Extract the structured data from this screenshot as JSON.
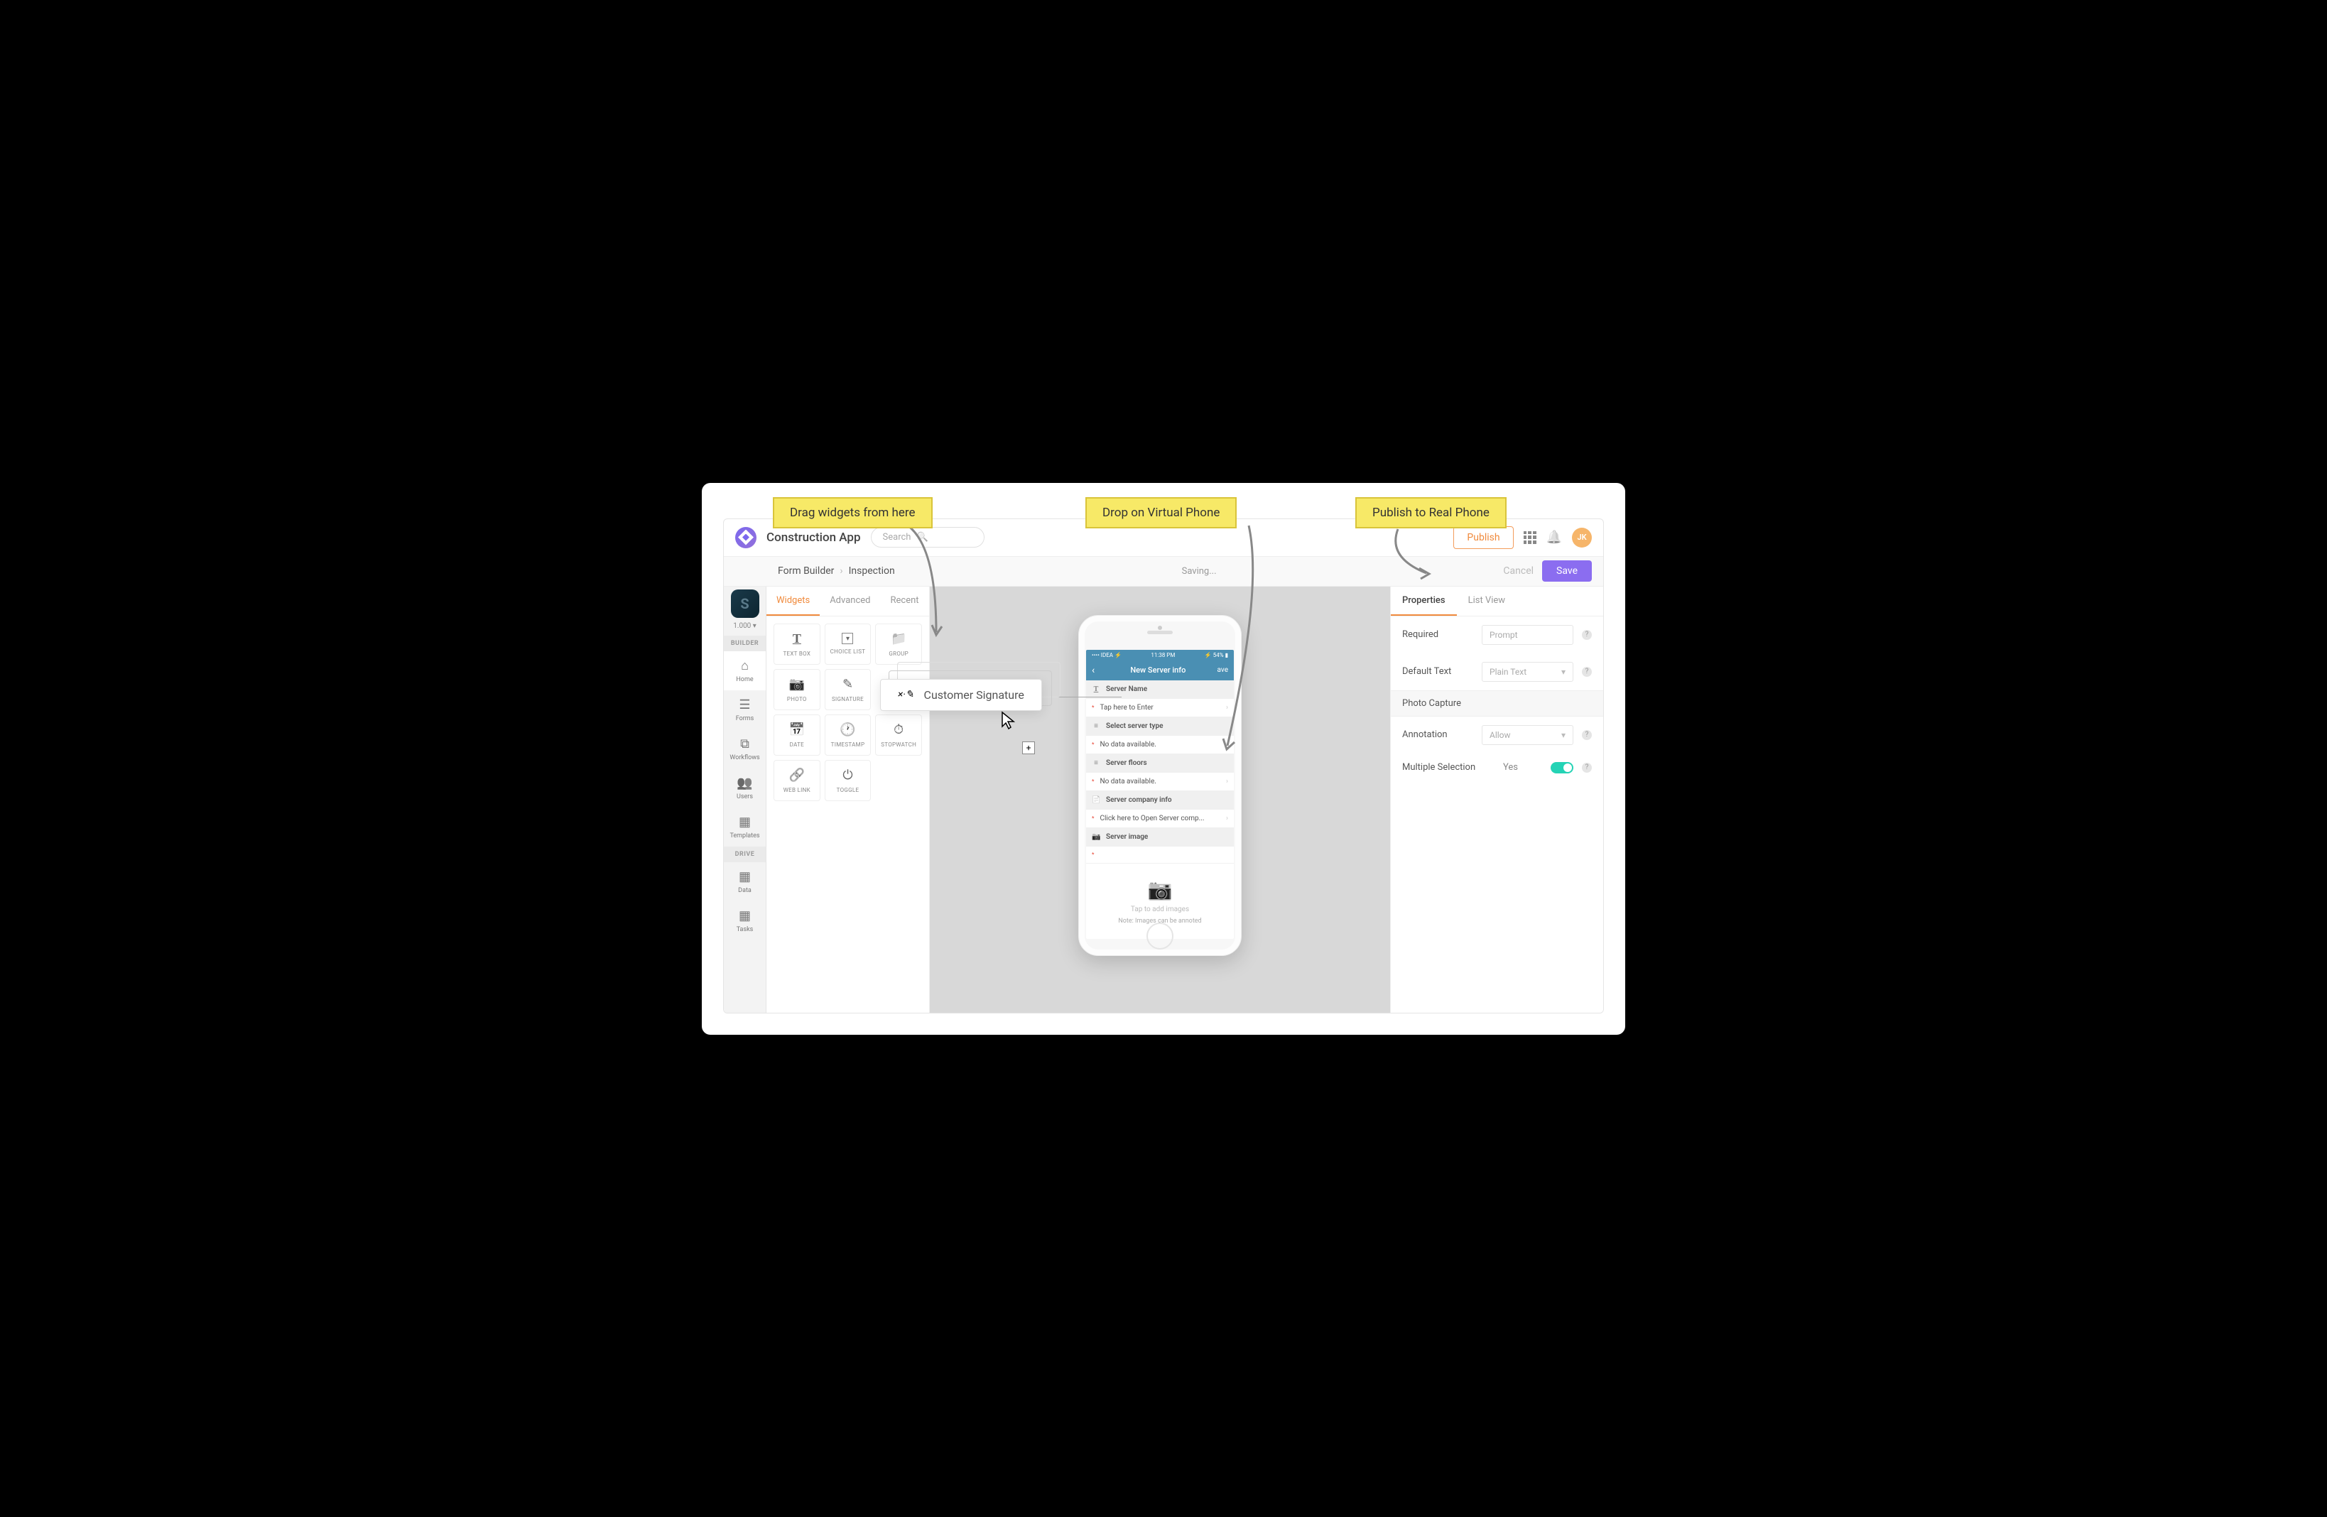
{
  "callouts": {
    "drag": "Drag widgets from here",
    "drop": "Drop on Virtual Phone",
    "publish": "Publish to Real Phone"
  },
  "header": {
    "app_title": "Construction App",
    "search_placeholder": "Search",
    "publish": "Publish",
    "avatar_initials": "JK"
  },
  "subheader": {
    "form_builder": "Form Builder",
    "crumb": "Inspection",
    "status": "Saving...",
    "cancel": "Cancel",
    "save": "Save"
  },
  "sidebar": {
    "version": "1.000",
    "builder_label": "BUILDER",
    "drive_label": "DRIVE",
    "items": {
      "home": "Home",
      "forms": "Forms",
      "workflows": "Workflows",
      "users": "Users",
      "templates": "Templates",
      "data": "Data",
      "tasks": "Tasks"
    }
  },
  "wtabs": {
    "widgets": "Widgets",
    "advanced": "Advanced",
    "recent": "Recent"
  },
  "widgets": {
    "text": "TEXT BOX",
    "choice": "CHOICE LIST",
    "group": "GROUP",
    "photo": "PHOTO",
    "sig": "SIGNATURE",
    "date": "DATE",
    "time": "TIMESTAMP",
    "stop": "STOPWATCH",
    "link": "WEB LINK",
    "toggle": "TOGGLE"
  },
  "drag_ghost": {
    "label": "Customer Signature",
    "sig_mark": "×·✎"
  },
  "phone": {
    "carrier": "IDEA",
    "time": "11:38 PM",
    "battery": "54%",
    "title": "New Server info",
    "save": "ave",
    "rows": {
      "server_name": "Server Name",
      "tap_enter": "Tap here to Enter",
      "select_type": "Select server type",
      "no_data": "No data available.",
      "floors": "Server floors",
      "company": "Server company info",
      "open_company": "Click here to Open Server comp...",
      "image": "Server image",
      "tap_images": "Tap to add images",
      "note": "Note: Images can be annoted"
    }
  },
  "props": {
    "tab_properties": "Properties",
    "tab_list": "List View",
    "required": "Required",
    "required_val": "Prompt",
    "default_text": "Default Text",
    "default_text_val": "Plain Text",
    "section": "Photo Capture",
    "annotation": "Annotation",
    "annotation_val": "Allow",
    "multi": "Multiple Selection",
    "multi_val": "Yes"
  }
}
